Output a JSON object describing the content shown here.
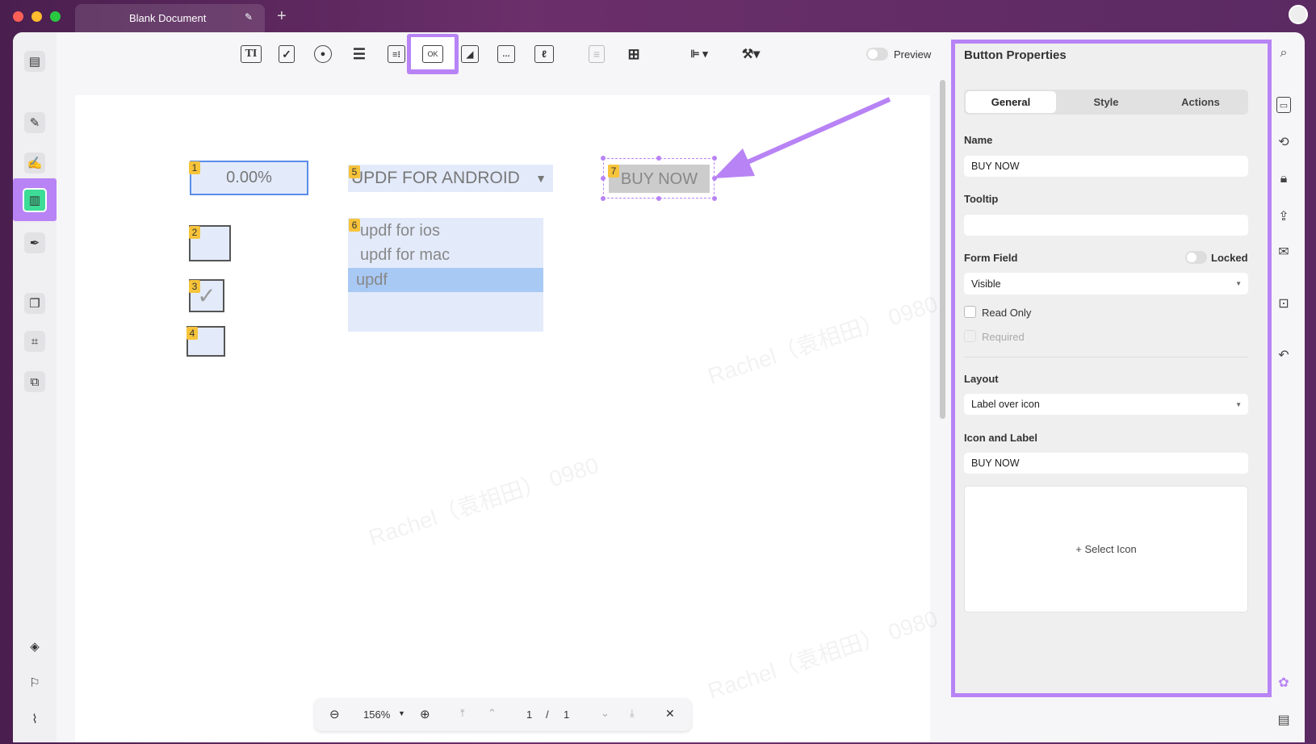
{
  "window": {
    "tab_title": "Blank Document",
    "new_tab": "+",
    "edit_icon": "pencil-icon"
  },
  "toolbar": {
    "tools": [
      "text-field-icon",
      "checkbox-icon",
      "radio-button-icon",
      "combo-box-icon",
      "list-box-icon",
      "button-icon",
      "image-field-icon",
      "date-field-icon",
      "signature-field-icon",
      "duplicate-icon",
      "grid-icon",
      "align-icon",
      "tools-icon"
    ],
    "button_tool_label": "OK",
    "text_tool_label": "TI",
    "preview_label": "Preview",
    "preview_on": false
  },
  "left_sidebar": {
    "items": [
      "reader-icon",
      "highlighter-icon",
      "edit-pdf-icon",
      "prepare-form-icon",
      "fill-sign-icon",
      "organize-pages-icon",
      "crop-icon",
      "compress-icon",
      "layers-icon",
      "bookmark-icon",
      "attachment-icon"
    ],
    "active": "prepare-form-icon"
  },
  "form": {
    "field1": {
      "number": "1",
      "value": "0.00%"
    },
    "field2": {
      "number": "2"
    },
    "field3": {
      "number": "3",
      "check": "✓"
    },
    "field4": {
      "number": "4"
    },
    "field5": {
      "number": "5",
      "value": "UPDF FOR ANDROID"
    },
    "field6": {
      "number": "6",
      "options": [
        "updf for ios",
        "updf for mac",
        "updf"
      ],
      "selected": "updf"
    },
    "field7": {
      "number": "7",
      "label": "BUY NOW"
    }
  },
  "watermark": "Rachel（袁相田） 0980",
  "bottom_bar": {
    "zoom": "156%",
    "page_current": "1",
    "page_sep": "/",
    "page_total": "1"
  },
  "panel": {
    "title": "Button Properties",
    "tabs": [
      "General",
      "Style",
      "Actions"
    ],
    "active_tab": "General",
    "name_label": "Name",
    "name_value": "BUY NOW",
    "tooltip_label": "Tooltip",
    "tooltip_value": "",
    "form_field_label": "Form Field",
    "locked_label": "Locked",
    "locked_on": false,
    "visibility": "Visible",
    "read_only_label": "Read Only",
    "read_only": false,
    "required_label": "Required",
    "required": false,
    "layout_label": "Layout",
    "layout_value": "Label over icon",
    "icon_label_label": "Icon and Label",
    "icon_label_value": "BUY NOW",
    "select_icon": "+ Select Icon"
  },
  "right_bar": [
    "search-icon",
    "ocr-icon",
    "convert-icon",
    "protect-icon",
    "share-icon",
    "mail-icon",
    "save-icon",
    "undo-icon",
    "ai-assistant-icon",
    "comment-icon"
  ],
  "colors": {
    "highlight": "#b883f5",
    "field_fill": "#e3ebfb",
    "badge": "#f6c33a",
    "active_tool": "#3ddc97"
  }
}
